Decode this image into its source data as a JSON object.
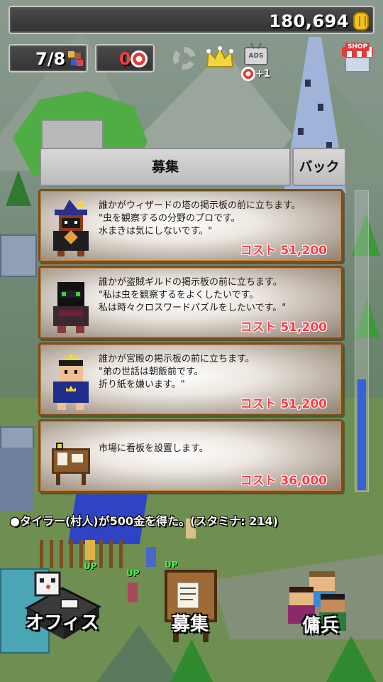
{
  "hud": {
    "gold": "180,694",
    "party": "7/8",
    "tickets": "0",
    "ads_label": "ADS",
    "ads_reward": "+1",
    "shop_label": "SHOP"
  },
  "dialog": {
    "title": "募集",
    "back_label": "バック",
    "cards": [
      {
        "portrait": "wizard-portrait-icon",
        "text": "誰かがウィザードの塔の掲示板の前に立ちます。\n\"虫を観察するの分野のプロです。\n水まきは気にしないです。\"",
        "cost": "コスト 51,200"
      },
      {
        "portrait": "thief-portrait-icon",
        "text": "誰かが盗賊ギルドの掲示板の前に立ちます。\n\"私は虫を観察するをよくしたいです。\n私は時々クロスワードパズルをしたいです。\"",
        "cost": "コスト 51,200"
      },
      {
        "portrait": "prince-portrait-icon",
        "text": "誰かが宮殿の掲示板の前に立ちます。\n\"弟の世話は朝飯前です。\n折り紙を嫌います。\"",
        "cost": "コスト 51,200"
      },
      {
        "portrait": "signboard-icon",
        "text": "市場に看板を設置します。",
        "cost": "コスト 36,000"
      }
    ]
  },
  "message": "●タイラー(村人)が500金を得た。(スタミナ: 214)",
  "scroll_position": 0.63,
  "menu": {
    "office_label": "オフィス",
    "recruit_label": "募集",
    "mercenary_label": "傭兵"
  },
  "level_up_badge": "UP",
  "colors": {
    "cost": "#ff3a48",
    "tickets": "#ff3b3b",
    "scroll_thumb": "#3562d6",
    "card_border": "#7a4e1e"
  }
}
